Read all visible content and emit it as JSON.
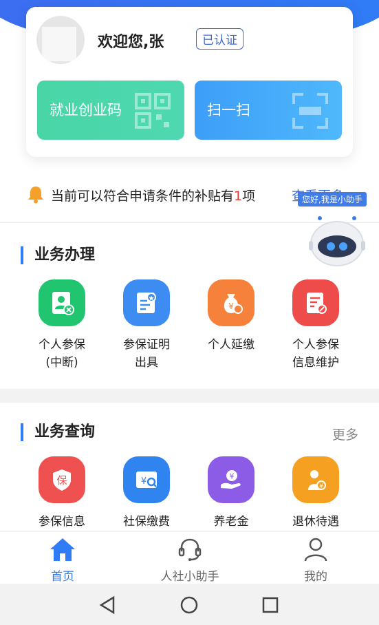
{
  "user": {
    "welcome": "欢迎您,张",
    "verified_badge": "已认证"
  },
  "actions": {
    "employment_code": "就业创业码",
    "scan": "扫一扫"
  },
  "notice": {
    "prefix": "当前可以符合申请条件的补贴有",
    "count": "1",
    "suffix": "项",
    "more": "查看更多"
  },
  "assistant": {
    "tooltip": "您好,我是小助手"
  },
  "business_handling": {
    "title": "业务办理",
    "items": [
      {
        "label": "个人参保\n(中断)",
        "icon": "person-insurance-icon",
        "color": "#21c46f"
      },
      {
        "label": "参保证明\n出具",
        "icon": "certificate-icon",
        "color": "#3c8cf2"
      },
      {
        "label": "个人延缴",
        "icon": "money-bag-icon",
        "color": "#f5813a"
      },
      {
        "label": "个人参保\n信息维护",
        "icon": "edit-document-icon",
        "color": "#ee4b4b"
      }
    ]
  },
  "business_query": {
    "title": "业务查询",
    "more": "更多",
    "items": [
      {
        "label": "参保信息",
        "icon": "shield-insurance-icon",
        "color": "#ef5151"
      },
      {
        "label": "社保缴费",
        "icon": "payment-search-icon",
        "color": "#2f84f0"
      },
      {
        "label": "养老金",
        "icon": "pension-hand-icon",
        "color": "#8c5ce6"
      },
      {
        "label": "退休待遇",
        "icon": "retiree-icon",
        "color": "#f5a020"
      }
    ]
  },
  "tabs": [
    {
      "label": "首页",
      "icon": "home-icon",
      "active": true
    },
    {
      "label": "人社小助手",
      "icon": "headset-icon",
      "active": false
    },
    {
      "label": "我的",
      "icon": "user-icon",
      "active": false
    }
  ],
  "colors": {
    "primary": "#2f7cf6",
    "accent_red": "#e53935",
    "tab_active": "#2f7cf6",
    "tab_inactive": "#666666"
  }
}
